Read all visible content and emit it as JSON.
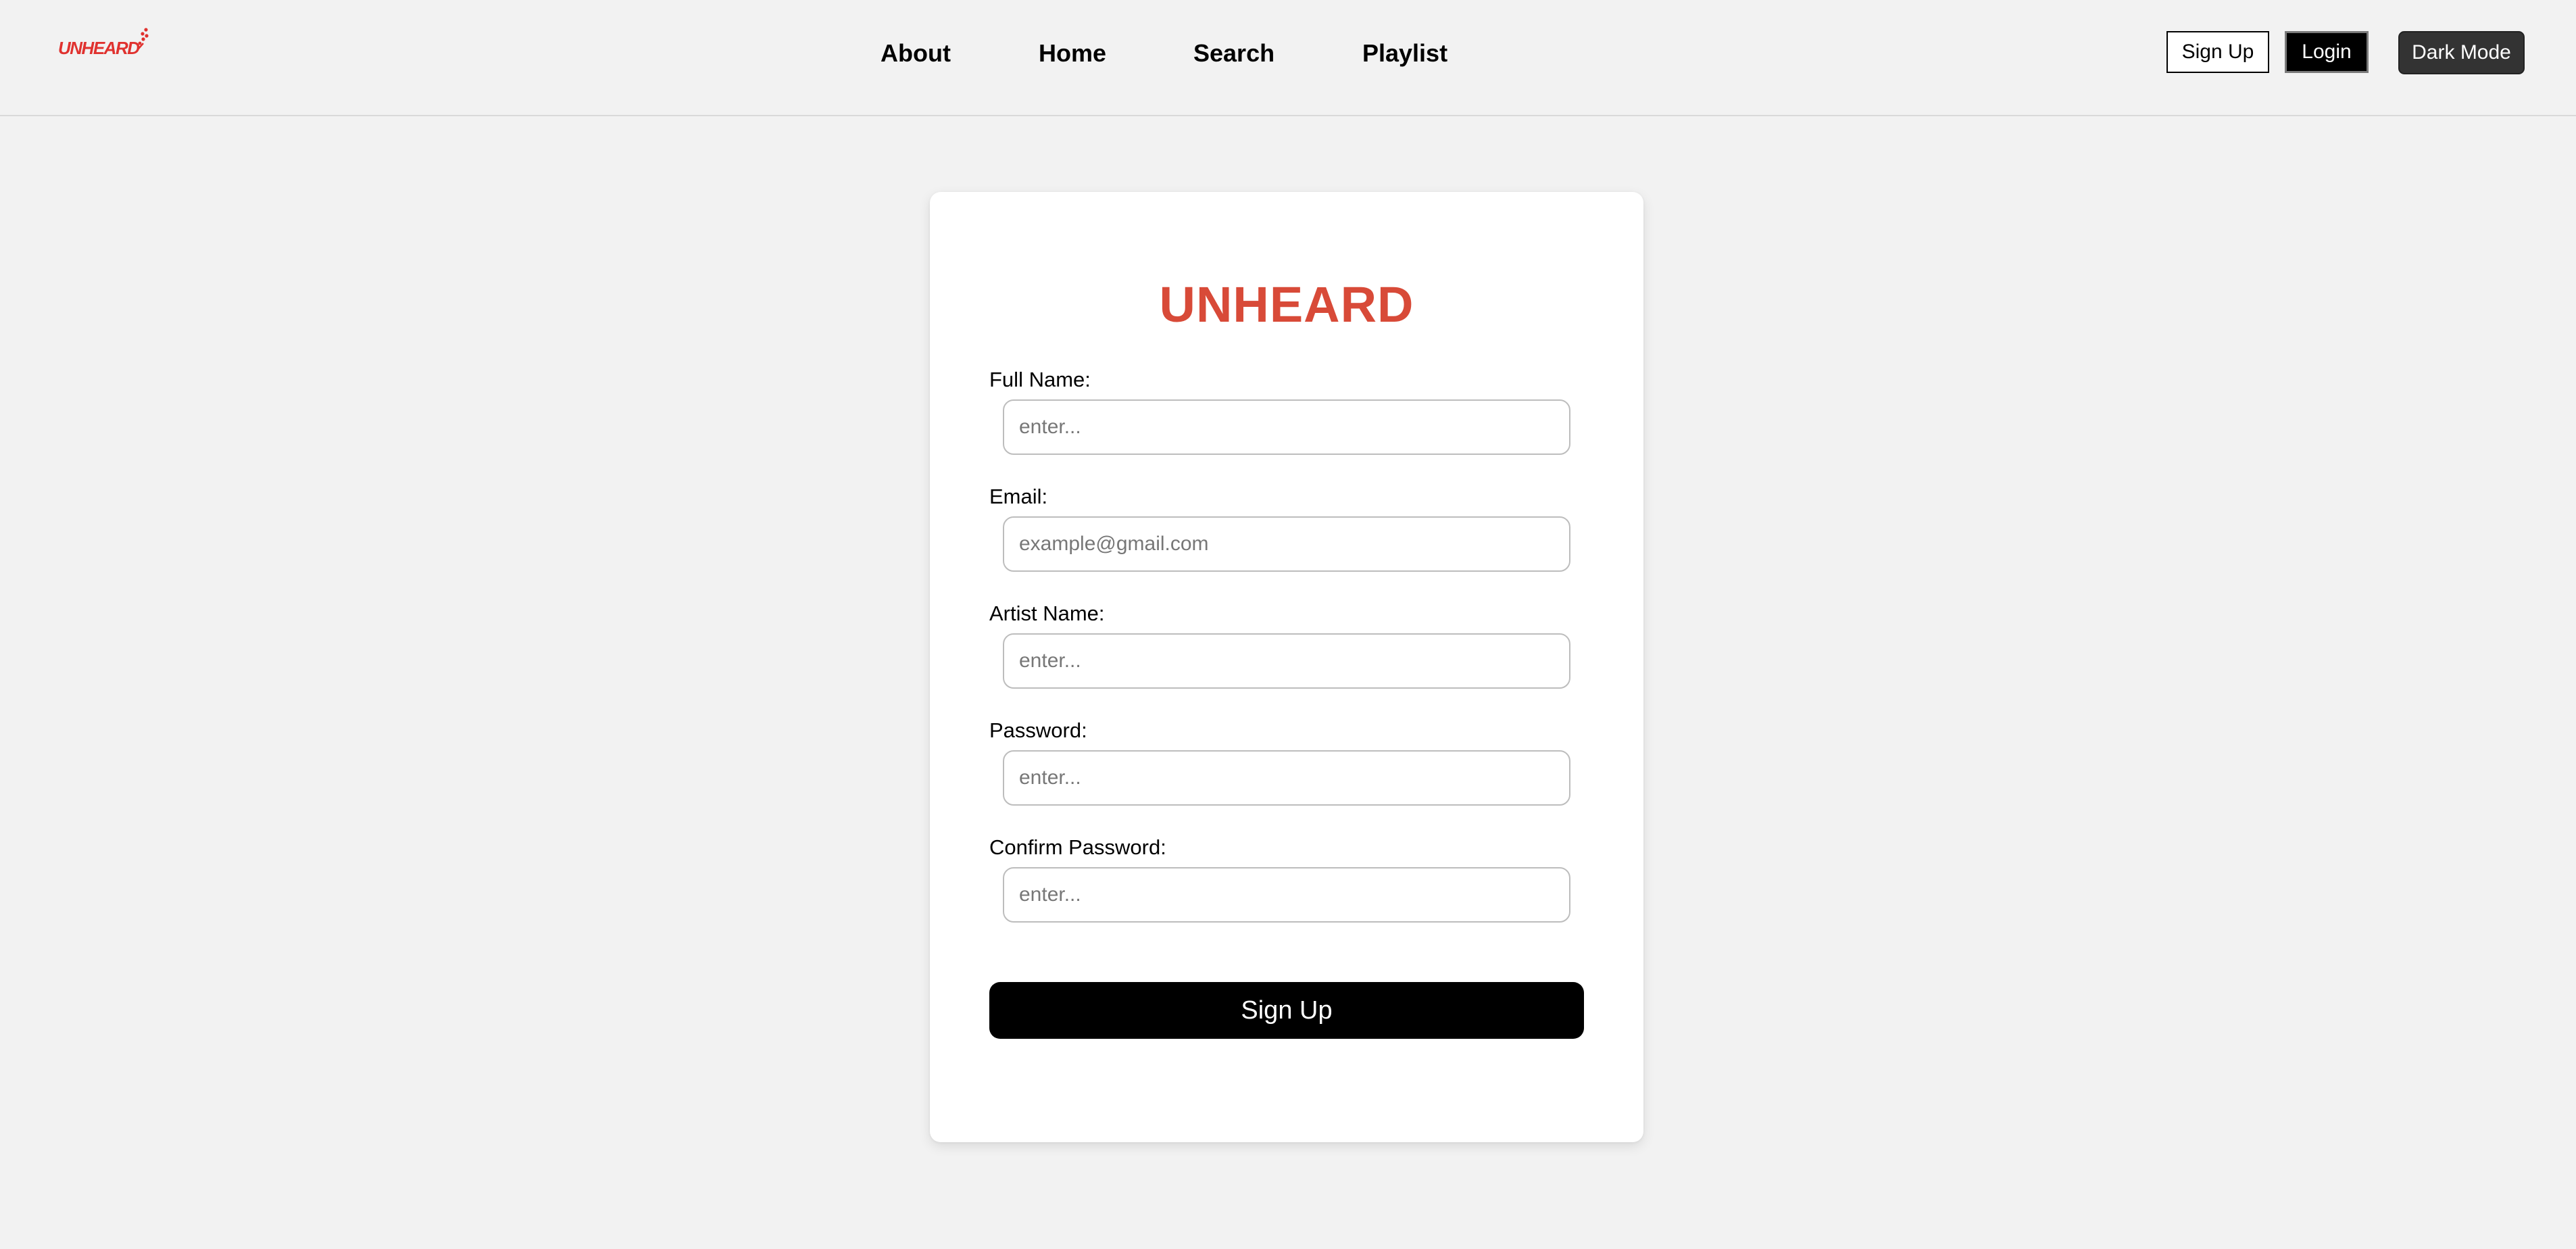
{
  "header": {
    "logo_text": "UNHEARD",
    "nav": [
      {
        "label": "About"
      },
      {
        "label": "Home"
      },
      {
        "label": "Search"
      },
      {
        "label": "Playlist"
      }
    ],
    "signup_label": "Sign Up",
    "login_label": "Login",
    "dark_mode_label": "Dark Mode"
  },
  "form": {
    "title": "UNHEARD",
    "fields": [
      {
        "label": "Full Name:",
        "placeholder": "enter...",
        "value": ""
      },
      {
        "label": "Email:",
        "placeholder": "example@gmail.com",
        "value": ""
      },
      {
        "label": "Artist Name:",
        "placeholder": "enter...",
        "value": ""
      },
      {
        "label": "Password:",
        "placeholder": "enter...",
        "value": ""
      },
      {
        "label": "Confirm Password:",
        "placeholder": "enter...",
        "value": ""
      }
    ],
    "submit_label": "Sign Up"
  },
  "colors": {
    "page_background": "#f2f2f2",
    "brand_red": "#d84a38",
    "logo_red": "#e0322f",
    "primary_button": "#000000",
    "dark_mode_button": "#333333"
  },
  "icons": {
    "logo": "unheard-logo-icon"
  }
}
